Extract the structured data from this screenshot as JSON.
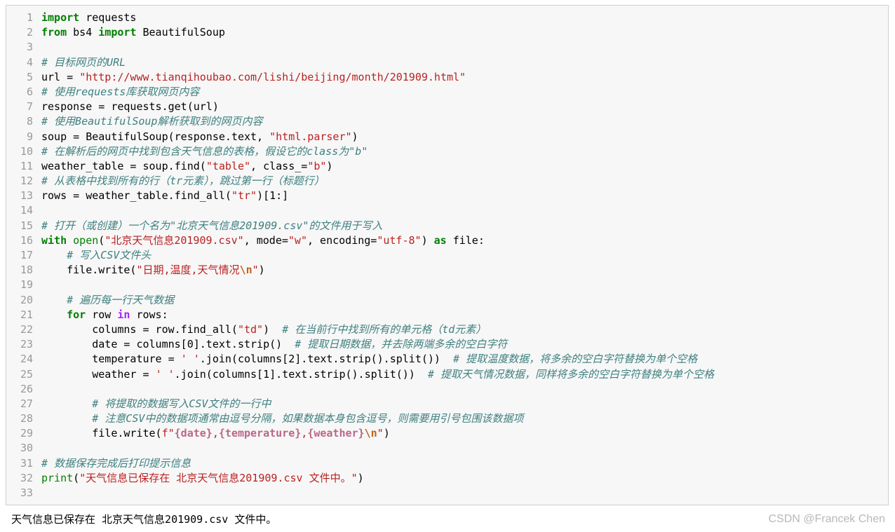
{
  "colors": {
    "keyword": "#008000",
    "string": "#ba2121",
    "comment": "#408080",
    "line_number": "#999999",
    "cell_background": "#f7f7f7",
    "cell_border": "#cfcfcf",
    "watermark": "#b8b8b8"
  },
  "code_lines": [
    {
      "num": "1",
      "tokens": [
        [
          "kw",
          "import"
        ],
        [
          "plain",
          " requests"
        ]
      ]
    },
    {
      "num": "2",
      "tokens": [
        [
          "kw",
          "from"
        ],
        [
          "plain",
          " bs4 "
        ],
        [
          "kw",
          "import"
        ],
        [
          "plain",
          " BeautifulSoup"
        ]
      ]
    },
    {
      "num": "3",
      "tokens": []
    },
    {
      "num": "4",
      "tokens": [
        [
          "com",
          "# 目标网页的URL"
        ]
      ]
    },
    {
      "num": "5",
      "tokens": [
        [
          "plain",
          "url = "
        ],
        [
          "str",
          "\"http://www.tianqihoubao.com/lishi/beijing/month/201909.html\""
        ]
      ]
    },
    {
      "num": "6",
      "tokens": [
        [
          "com",
          "# 使用requests库获取网页内容"
        ]
      ]
    },
    {
      "num": "7",
      "tokens": [
        [
          "plain",
          "response = requests.get(url)"
        ]
      ]
    },
    {
      "num": "8",
      "tokens": [
        [
          "com",
          "# 使用BeautifulSoup解析获取到的网页内容"
        ]
      ]
    },
    {
      "num": "9",
      "tokens": [
        [
          "plain",
          "soup = BeautifulSoup(response.text, "
        ],
        [
          "str",
          "\"html.parser\""
        ],
        [
          "plain",
          ")"
        ]
      ]
    },
    {
      "num": "10",
      "tokens": [
        [
          "com",
          "# 在解析后的网页中找到包含天气信息的表格，假设它的class为\"b\""
        ]
      ]
    },
    {
      "num": "11",
      "tokens": [
        [
          "plain",
          "weather_table = soup.find("
        ],
        [
          "str",
          "\"table\""
        ],
        [
          "plain",
          ", class_="
        ],
        [
          "str",
          "\"b\""
        ],
        [
          "plain",
          ")"
        ]
      ]
    },
    {
      "num": "12",
      "tokens": [
        [
          "com",
          "# 从表格中找到所有的行（tr元素），跳过第一行（标题行）"
        ]
      ]
    },
    {
      "num": "13",
      "tokens": [
        [
          "plain",
          "rows = weather_table.find_all("
        ],
        [
          "str",
          "\"tr\""
        ],
        [
          "plain",
          ")[1:]"
        ]
      ]
    },
    {
      "num": "14",
      "tokens": []
    },
    {
      "num": "15",
      "tokens": [
        [
          "com",
          "# 打开（或创建）一个名为\"北京天气信息201909.csv\"的文件用于写入"
        ]
      ]
    },
    {
      "num": "16",
      "tokens": [
        [
          "kw",
          "with"
        ],
        [
          "plain",
          " "
        ],
        [
          "bi",
          "open"
        ],
        [
          "plain",
          "("
        ],
        [
          "str",
          "\"北京天气信息201909.csv\""
        ],
        [
          "plain",
          ", mode="
        ],
        [
          "str",
          "\"w\""
        ],
        [
          "plain",
          ", encoding="
        ],
        [
          "str",
          "\"utf-8\""
        ],
        [
          "plain",
          ") "
        ],
        [
          "kw",
          "as"
        ],
        [
          "plain",
          " file:"
        ]
      ]
    },
    {
      "num": "17",
      "tokens": [
        [
          "plain",
          "    "
        ],
        [
          "com",
          "# 写入CSV文件头"
        ]
      ]
    },
    {
      "num": "18",
      "tokens": [
        [
          "plain",
          "    file.write("
        ],
        [
          "str",
          "\"日期,温度,天气情况"
        ],
        [
          "esc",
          "\\n"
        ],
        [
          "str",
          "\""
        ],
        [
          "plain",
          ")"
        ]
      ]
    },
    {
      "num": "19",
      "tokens": []
    },
    {
      "num": "20",
      "tokens": [
        [
          "plain",
          "    "
        ],
        [
          "com",
          "# 遍历每一行天气数据"
        ]
      ]
    },
    {
      "num": "21",
      "tokens": [
        [
          "plain",
          "    "
        ],
        [
          "kw",
          "for"
        ],
        [
          "plain",
          " row "
        ],
        [
          "op",
          "in"
        ],
        [
          "plain",
          " rows:"
        ]
      ]
    },
    {
      "num": "22",
      "tokens": [
        [
          "plain",
          "        columns = row.find_all("
        ],
        [
          "str",
          "\"td\""
        ],
        [
          "plain",
          ")  "
        ],
        [
          "com",
          "# 在当前行中找到所有的单元格（td元素）"
        ]
      ]
    },
    {
      "num": "23",
      "tokens": [
        [
          "plain",
          "        date = columns[0].text.strip()  "
        ],
        [
          "com",
          "# 提取日期数据，并去除两端多余的空白字符"
        ]
      ]
    },
    {
      "num": "24",
      "tokens": [
        [
          "plain",
          "        temperature = "
        ],
        [
          "str",
          "' '"
        ],
        [
          "plain",
          ".join(columns[2].text.strip().split())  "
        ],
        [
          "com",
          "# 提取温度数据，将多余的空白字符替换为单个空格"
        ]
      ]
    },
    {
      "num": "25",
      "tokens": [
        [
          "plain",
          "        weather = "
        ],
        [
          "str",
          "' '"
        ],
        [
          "plain",
          ".join(columns[1].text.strip().split())  "
        ],
        [
          "com",
          "# 提取天气情况数据，同样将多余的空白字符替换为单个空格"
        ]
      ]
    },
    {
      "num": "26",
      "tokens": []
    },
    {
      "num": "27",
      "tokens": [
        [
          "plain",
          "        "
        ],
        [
          "com",
          "# 将提取的数据写入CSV文件的一行中"
        ]
      ]
    },
    {
      "num": "28",
      "tokens": [
        [
          "plain",
          "        "
        ],
        [
          "com",
          "# 注意CSV中的数据项通常由逗号分隔，如果数据本身包含逗号，则需要用引号包围该数据项"
        ]
      ]
    },
    {
      "num": "29",
      "tokens": [
        [
          "plain",
          "        file.write("
        ],
        [
          "str",
          "f\""
        ],
        [
          "int",
          "{date}"
        ],
        [
          "str",
          ","
        ],
        [
          "int",
          "{temperature}"
        ],
        [
          "str",
          ","
        ],
        [
          "int",
          "{weather}"
        ],
        [
          "esc",
          "\\n"
        ],
        [
          "str",
          "\""
        ],
        [
          "plain",
          ")"
        ]
      ]
    },
    {
      "num": "30",
      "tokens": []
    },
    {
      "num": "31",
      "tokens": [
        [
          "com",
          "# 数据保存完成后打印提示信息"
        ]
      ]
    },
    {
      "num": "32",
      "tokens": [
        [
          "bi",
          "print"
        ],
        [
          "plain",
          "("
        ],
        [
          "str",
          "\"天气信息已保存在 北京天气信息201909.csv 文件中。\""
        ],
        [
          "plain",
          ")"
        ]
      ]
    },
    {
      "num": "33",
      "tokens": []
    }
  ],
  "output_text": "天气信息已保存在 北京天气信息201909.csv 文件中。",
  "watermark": "CSDN @Francek Chen"
}
